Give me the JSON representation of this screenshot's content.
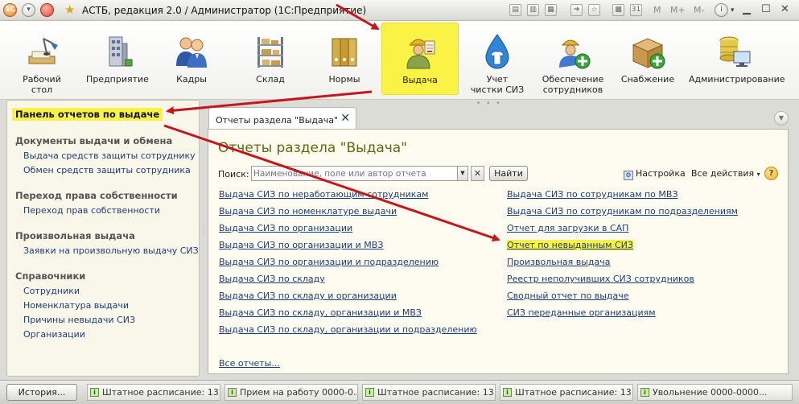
{
  "window": {
    "title": "АСТБ, редакция 2.0 / Администратор  (1С:Предприятие)",
    "logo": "1С",
    "memory_buttons": [
      "M",
      "M+",
      "M-"
    ]
  },
  "sections": [
    {
      "label": "Рабочий\nстол",
      "icon": "desk-lamp-icon"
    },
    {
      "label": "Предприятие",
      "icon": "building-icon"
    },
    {
      "label": "Кадры",
      "icon": "people-icon"
    },
    {
      "label": "Склад",
      "icon": "shelves-icon"
    },
    {
      "label": "Нормы",
      "icon": "binders-icon"
    },
    {
      "label": "Выдача",
      "icon": "worker-icon",
      "active": true
    },
    {
      "label": "Учет\nчистки СИЗ",
      "icon": "water-drop-shirt-icon"
    },
    {
      "label": "Обеспечение\nсотрудников",
      "icon": "worker-add-icon"
    },
    {
      "label": "Снабжение",
      "icon": "box-add-icon"
    },
    {
      "label": "Администрирование",
      "icon": "server-computer-icon"
    }
  ],
  "left_panel": {
    "title": "Панель отчетов по выдаче",
    "groups": [
      {
        "heading": "Документы выдачи и обмена",
        "items": [
          "Выдача средств защиты сотруднику",
          "Обмен средств защиты сотрудника"
        ]
      },
      {
        "heading": "Переход права собственности",
        "items": [
          "Переход прав собственности"
        ]
      },
      {
        "heading": "Произвольная выдача",
        "items": [
          "Заявки на произвольную выдачу СИЗ"
        ]
      },
      {
        "heading": "Справочники",
        "items": [
          "Сотрудники",
          "Номенклатура выдачи",
          "Причины невыдачи СИЗ",
          "Организации"
        ]
      }
    ]
  },
  "tab": {
    "label": "Отчеты раздела \"Выдача\""
  },
  "content": {
    "title": "Отчеты раздела \"Выдача\"",
    "search_label": "Поиск:",
    "search_placeholder": "Наименование, поле или автор отчета",
    "find_button": "Найти",
    "settings_label": "Настройка",
    "actions_label": "Все действия",
    "help": "?",
    "reports_left": [
      "Выдача СИЗ по неработающим сотрудникам",
      "Выдача СИЗ по номенклатуре выдачи",
      "Выдача СИЗ по организации",
      "Выдача СИЗ по организации и МВЗ",
      "Выдача СИЗ по организации и подразделению",
      "Выдача СИЗ по складу",
      "Выдача СИЗ по складу и организации",
      "Выдача СИЗ по складу, организации и МВЗ",
      "Выдача СИЗ по складу, организации и подразделению"
    ],
    "reports_right": [
      "Выдача СИЗ по сотрудникам по МВЗ",
      "Выдача СИЗ по сотрудникам по подразделениям",
      "Отчет для загрузки в САП",
      "Отчет по невыданным СИЗ",
      "Произвольная выдача",
      "Реестр неполучивших СИЗ сотрудников",
      "Сводный отчет по выдаче",
      "СИЗ переданные организациям"
    ],
    "all_reports": "Все отчеты..."
  },
  "statusbar": {
    "history_button": "История...",
    "windows": [
      "Штатное расписание: 13...",
      "Прием на работу 0000-0...",
      "Штатное расписание: 13...",
      "Штатное расписание: 13...",
      "Увольнение 0000-0000..."
    ]
  },
  "colors": {
    "highlight": "#fbf246",
    "link": "#1c3d7a",
    "title_green": "#5c6a11",
    "arrow": "#c4161c"
  }
}
